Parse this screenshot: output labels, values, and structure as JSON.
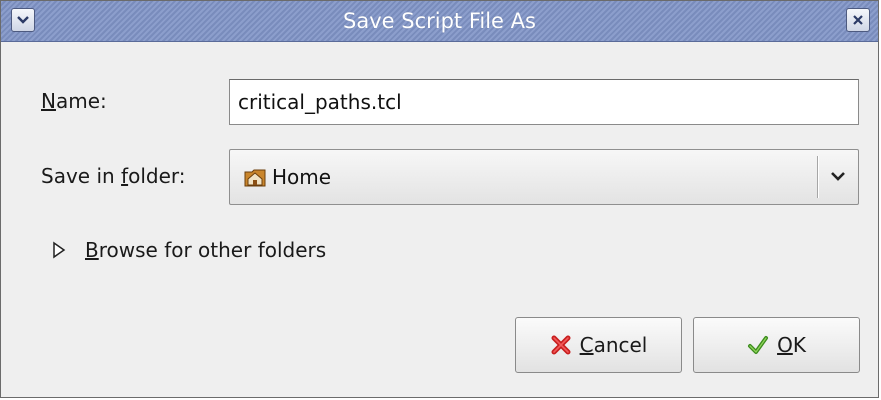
{
  "window": {
    "title": "Save Script File As",
    "menu_icon": "chevron-down-icon",
    "close_icon": "close-icon",
    "title_bar_color": "#7f93c6"
  },
  "form": {
    "name_label_mnemonic": "N",
    "name_label_rest": "ame:",
    "name_value": "critical_paths.tcl",
    "folder_label_prefix": "Save in ",
    "folder_label_mnemonic": "f",
    "folder_label_rest": "older:",
    "folder_value": "Home",
    "folder_icon": "home-folder-icon"
  },
  "browse": {
    "mnemonic": "B",
    "rest": "rowse for other folders",
    "icon": "expander-arrow-icon"
  },
  "buttons": {
    "cancel_mnemonic": "C",
    "cancel_rest": "ancel",
    "cancel_icon": "cancel-x-icon",
    "cancel_icon_color": "#c81e1e",
    "ok_mnemonic": "O",
    "ok_rest": "K",
    "ok_icon": "checkmark-icon",
    "ok_icon_color": "#3c8c1e"
  }
}
